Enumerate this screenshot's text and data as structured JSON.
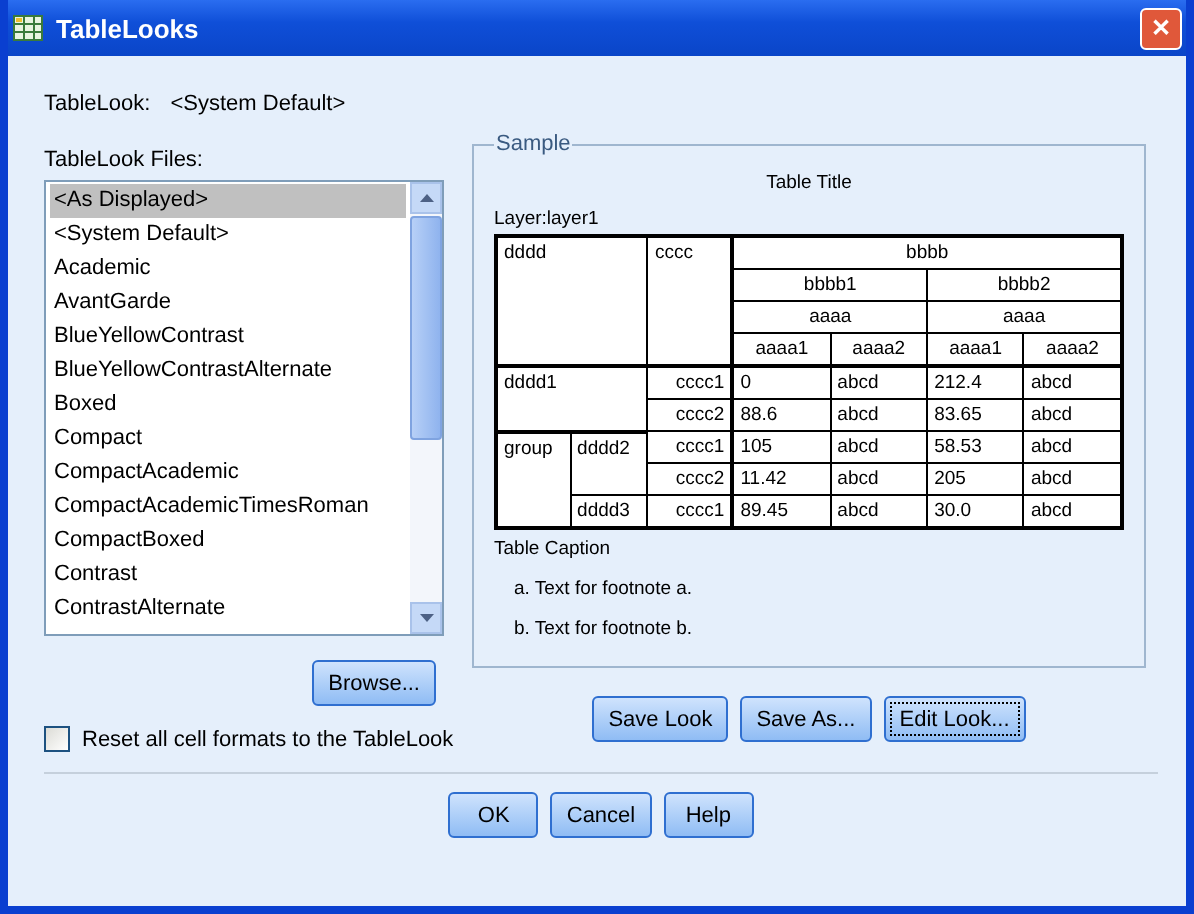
{
  "window": {
    "title": "TableLooks",
    "close": "✕"
  },
  "current_look": {
    "label": "TableLook:",
    "value": "<System Default>"
  },
  "files": {
    "label": "TableLook Files:",
    "items": [
      {
        "label": "<As Displayed>",
        "selected": true
      },
      {
        "label": "<System Default>",
        "selected": false
      },
      {
        "label": "Academic",
        "selected": false
      },
      {
        "label": "AvantGarde",
        "selected": false
      },
      {
        "label": "BlueYellowContrast",
        "selected": false
      },
      {
        "label": "BlueYellowContrastAlternate",
        "selected": false
      },
      {
        "label": "Boxed",
        "selected": false
      },
      {
        "label": "Compact",
        "selected": false
      },
      {
        "label": "CompactAcademic",
        "selected": false
      },
      {
        "label": "CompactAcademicTimesRoman",
        "selected": false
      },
      {
        "label": "CompactBoxed",
        "selected": false
      },
      {
        "label": "Contrast",
        "selected": false
      },
      {
        "label": "ContrastAlternate",
        "selected": false
      }
    ]
  },
  "browse_button": "Browse...",
  "reset_checkbox": {
    "label": "Reset all cell formats to the TableLook",
    "checked": false
  },
  "sample": {
    "legend": "Sample",
    "title": "Table Title",
    "layer": "Layer:layer1",
    "corner": {
      "row_label": "dddd",
      "column_label": "cccc"
    },
    "column_header": {
      "title": "bbbb",
      "groups": [
        {
          "label": "bbbb1",
          "sublabel": "aaaa",
          "leaves": [
            "aaaa1",
            "aaaa2"
          ]
        },
        {
          "label": "bbbb2",
          "sublabel": "aaaa",
          "leaves": [
            "aaaa1",
            "aaaa2"
          ]
        }
      ]
    },
    "row_groups": [
      {
        "label": "dddd1",
        "rows": [
          {
            "category": "cccc1",
            "values": [
              "0",
              "abcd",
              "212.4",
              "abcd"
            ]
          },
          {
            "category": "cccc2",
            "values": [
              "88.6",
              "abcd",
              "83.65",
              "abcd"
            ]
          }
        ]
      },
      {
        "label": "group",
        "children": [
          {
            "label": "dddd2",
            "rows": [
              {
                "category": "cccc1",
                "values": [
                  "105",
                  "abcd",
                  "58.53",
                  "abcd"
                ]
              },
              {
                "category": "cccc2",
                "values": [
                  "11.42",
                  "abcd",
                  "205",
                  "abcd"
                ]
              }
            ]
          },
          {
            "label": "dddd3",
            "rows": [
              {
                "category": "cccc1",
                "values": [
                  "89.45",
                  "abcd",
                  "30.0",
                  "abcd"
                ]
              }
            ]
          }
        ]
      }
    ],
    "caption": "Table Caption",
    "footnotes": [
      "a. Text for footnote a.",
      "b. Text for footnote b."
    ]
  },
  "look_buttons": [
    {
      "label": "Save Look",
      "focused": false
    },
    {
      "label": "Save As...",
      "focused": false
    },
    {
      "label": "Edit Look...",
      "focused": true
    }
  ],
  "dialog_buttons": [
    "OK",
    "Cancel",
    "Help"
  ]
}
